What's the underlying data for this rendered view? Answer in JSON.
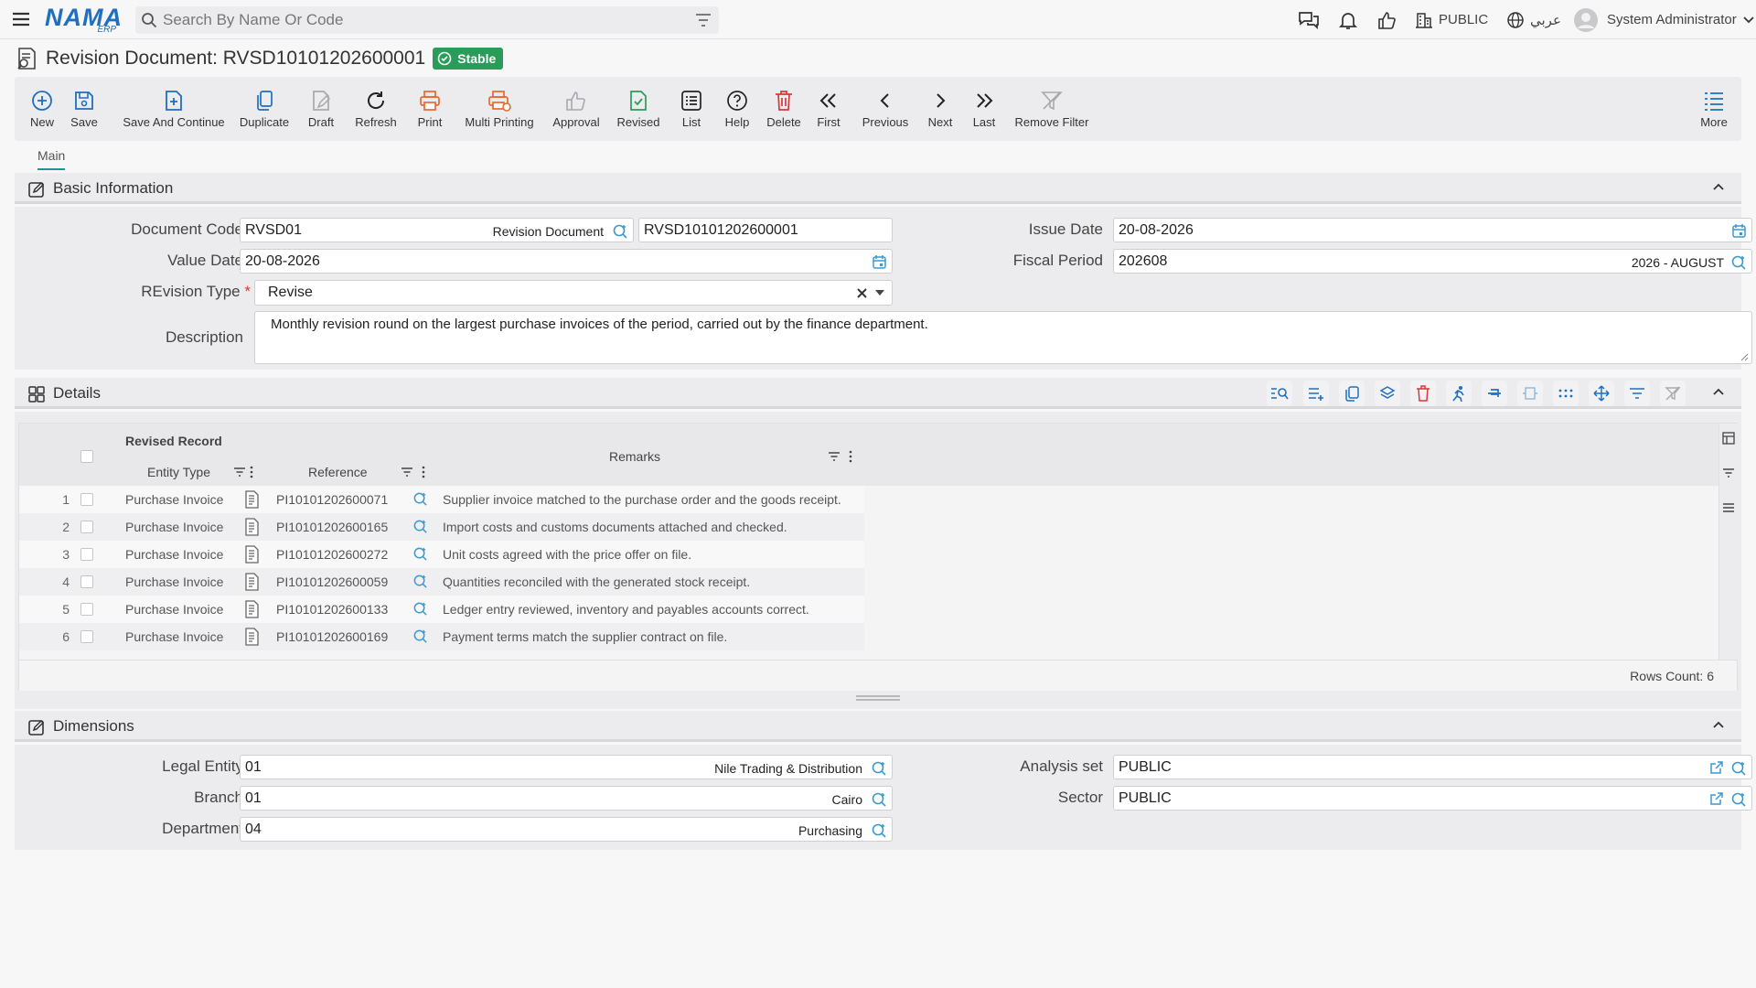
{
  "topbar": {
    "logo_text": "NAMA",
    "logo_sub": "ERP",
    "search_placeholder": "Search By Name Or Code",
    "company_label": "PUBLIC",
    "language_label": "عربي",
    "user_name": "System Administrator"
  },
  "page": {
    "title": "Revision Document: RVSD10101202600001",
    "status": "Stable"
  },
  "toolbar": [
    {
      "label": "New",
      "icon": "plus-circle-icon"
    },
    {
      "label": "Save",
      "icon": "save-icon"
    },
    {
      "label": "Save And Continue",
      "icon": "save-continue-icon"
    },
    {
      "label": "Duplicate",
      "icon": "duplicate-icon"
    },
    {
      "label": "Draft",
      "icon": "draft-icon"
    },
    {
      "label": "Refresh",
      "icon": "refresh-icon"
    },
    {
      "label": "Print",
      "icon": "print-icon"
    },
    {
      "label": "Multi Printing",
      "icon": "multi-print-icon"
    },
    {
      "label": "Approval",
      "icon": "thumb-up-icon"
    },
    {
      "label": "Revised",
      "icon": "revised-icon"
    },
    {
      "label": "List",
      "icon": "list-icon"
    },
    {
      "label": "Help",
      "icon": "help-icon"
    },
    {
      "label": "Delete",
      "icon": "trash-icon"
    },
    {
      "label": "First",
      "icon": "first-icon"
    },
    {
      "label": "Previous",
      "icon": "previous-icon"
    },
    {
      "label": "Next",
      "icon": "next-icon"
    },
    {
      "label": "Last",
      "icon": "last-icon"
    },
    {
      "label": "Remove Filter",
      "icon": "remove-filter-icon"
    },
    {
      "label": "More",
      "icon": "more-icon"
    }
  ],
  "tabs": {
    "main": "Main"
  },
  "basic": {
    "section_title": "Basic Information",
    "document_code_label": "Document Code",
    "document_code": "RVSD01",
    "document_code_desc": "Revision Document",
    "document_number": "RVSD10101202600001",
    "issue_date_label": "Issue Date",
    "issue_date": "20-08-2026",
    "value_date_label": "Value Date",
    "value_date": "20-08-2026",
    "fiscal_period_label": "Fiscal Period",
    "fiscal_period": "202608",
    "fiscal_period_desc": "2026 - AUGUST",
    "revision_type_label": "REvision Type",
    "required_mark": "*",
    "revision_type": "Revise",
    "description_label": "Description",
    "description": "Monthly revision round on the largest purchase invoices of the period, carried out by the finance department."
  },
  "details": {
    "section_title": "Details",
    "group_header": "Revised Record",
    "columns": {
      "entity_type": "Entity Type",
      "reference": "Reference",
      "remarks": "Remarks"
    },
    "rows": [
      {
        "num": "1",
        "entity_type": "Purchase Invoice",
        "reference": "PI10101202600071",
        "remarks": "Supplier invoice matched to the purchase order and the goods receipt."
      },
      {
        "num": "2",
        "entity_type": "Purchase Invoice",
        "reference": "PI10101202600165",
        "remarks": "Import costs and customs documents attached and checked."
      },
      {
        "num": "3",
        "entity_type": "Purchase Invoice",
        "reference": "PI10101202600272",
        "remarks": "Unit costs agreed with the price offer on file."
      },
      {
        "num": "4",
        "entity_type": "Purchase Invoice",
        "reference": "PI10101202600059",
        "remarks": "Quantities reconciled with the generated stock receipt."
      },
      {
        "num": "5",
        "entity_type": "Purchase Invoice",
        "reference": "PI10101202600133",
        "remarks": "Ledger entry reviewed, inventory and payables accounts correct."
      },
      {
        "num": "6",
        "entity_type": "Purchase Invoice",
        "reference": "PI10101202600169",
        "remarks": "Payment terms match the supplier contract on file."
      }
    ],
    "rows_count": "Rows Count: 6"
  },
  "dimensions": {
    "section_title": "Dimensions",
    "legal_entity_label": "Legal Entity",
    "legal_entity_code": "01",
    "legal_entity_name": "Nile Trading & Distribution",
    "analysis_set_label": "Analysis set",
    "analysis_set": "PUBLIC",
    "branch_label": "Branch",
    "branch_code": "01",
    "branch_name": "Cairo",
    "sector_label": "Sector",
    "sector": "PUBLIC",
    "department_label": "Department",
    "department_code": "04",
    "department_name": "Purchasing"
  },
  "colors": {
    "accent": "#2a8f8f",
    "logo": "#1f6fc0",
    "stable": "#2a9c5a",
    "print": "#e8692a",
    "delete": "#d33a3a",
    "revised": "#2a9c5a"
  }
}
